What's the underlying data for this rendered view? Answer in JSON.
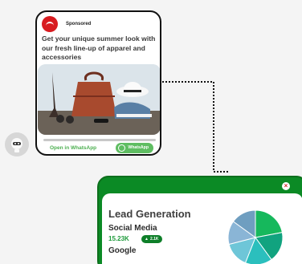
{
  "ad": {
    "sponsored": "Sponsored",
    "headline": "Get your unique summer look with our fresh line-up of apparel and accessories",
    "open_whatsapp": "Open in WhatsApp",
    "whatsapp_button": "WhatsApp",
    "logo_icon": "brand-logo-icon",
    "colors": {
      "accent": "#5fbd62",
      "logo": "#d81b20"
    }
  },
  "lead": {
    "title": "Lead Generation",
    "sources": [
      {
        "name": "Social Media",
        "count": "15.23K",
        "badge": "2.1K"
      },
      {
        "name": "Google"
      }
    ],
    "close_icon": "close-icon",
    "colors": {
      "header": "#0b8a25",
      "count": "#1f9b3c"
    }
  },
  "chart_data": {
    "type": "pie",
    "values": [
      22,
      18,
      16,
      15,
      14,
      15
    ],
    "colors": [
      "#16b85c",
      "#11a37f",
      "#2bbfbd",
      "#6ec6d8",
      "#8ab5d6",
      "#6f9ec0"
    ]
  }
}
